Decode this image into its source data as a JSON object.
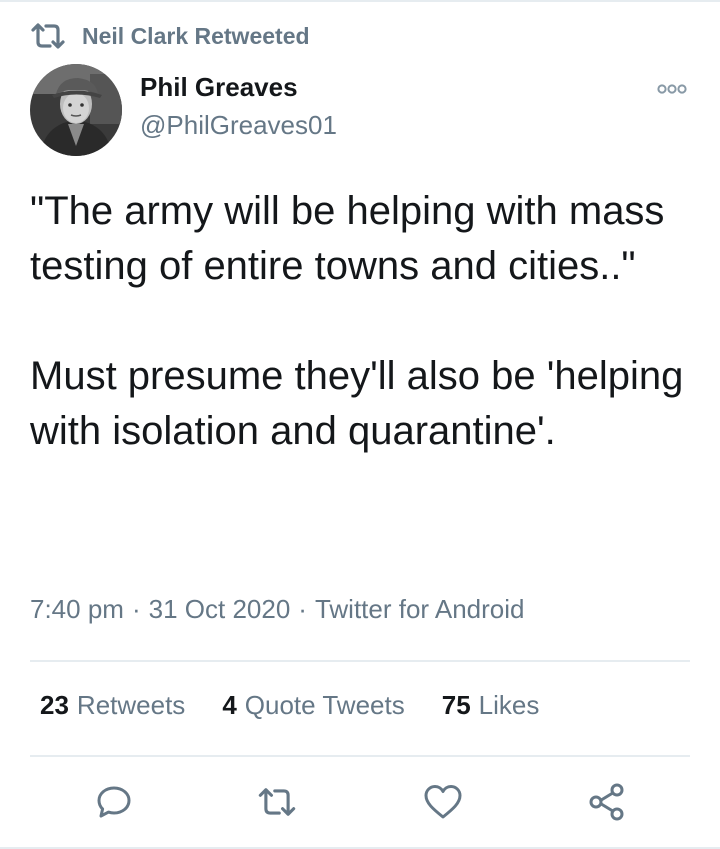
{
  "retweet_context": {
    "icon": "retweet-icon",
    "text": "Neil Clark Retweeted"
  },
  "author": {
    "name": "Phil Greaves",
    "handle": "@PhilGreaves01"
  },
  "tweet": {
    "paragraphs": [
      "\"The army will be helping with mass testing of entire towns and cities..\"",
      "Must presume they'll also be 'helping with isolation and quarantine'."
    ],
    "time": "7:40 pm",
    "date": "31 Oct 2020",
    "client": "Twitter for Android",
    "separator": "·"
  },
  "stats": {
    "retweets_count": "23",
    "retweets_label": "Retweets",
    "quotes_count": "4",
    "quotes_label": "Quote Tweets",
    "likes_count": "75",
    "likes_label": "Likes"
  },
  "actions": [
    "reply-icon",
    "retweet-icon",
    "like-icon",
    "share-icon"
  ],
  "colors": {
    "text": "#14171a",
    "secondary": "#657786",
    "divider": "#e6ecf0"
  }
}
